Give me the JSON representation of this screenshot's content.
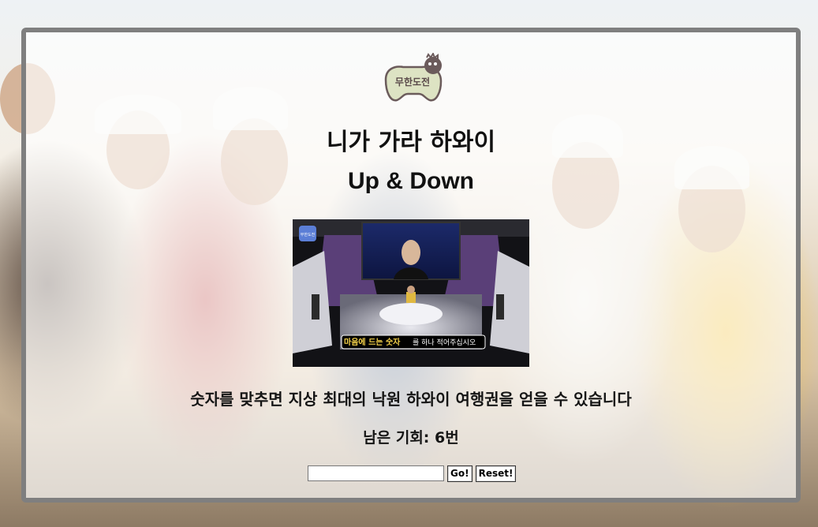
{
  "logo": {
    "text": "무한도전"
  },
  "title": {
    "line1": "니가 가라 하와이",
    "line2": "Up & Down"
  },
  "screenshot": {
    "caption_highlight": "마음에 드는 숫자",
    "caption_rest": "를 하나 적어주십시오",
    "corner_logo": "무한도전"
  },
  "description": "숫자를 맞추면 지상 최대의 낙원 하와이 여행권을 얻을 수 있습니다",
  "chances": "남은 기회: 6번",
  "controls": {
    "guess_value": "",
    "go_label": "Go!",
    "reset_label": "Reset!"
  },
  "colors": {
    "panel_border": "#7f7f7f",
    "logo_fill": "#dde3c3",
    "logo_stroke": "#6b5b5b",
    "caption_highlight": "#f5d24a"
  }
}
